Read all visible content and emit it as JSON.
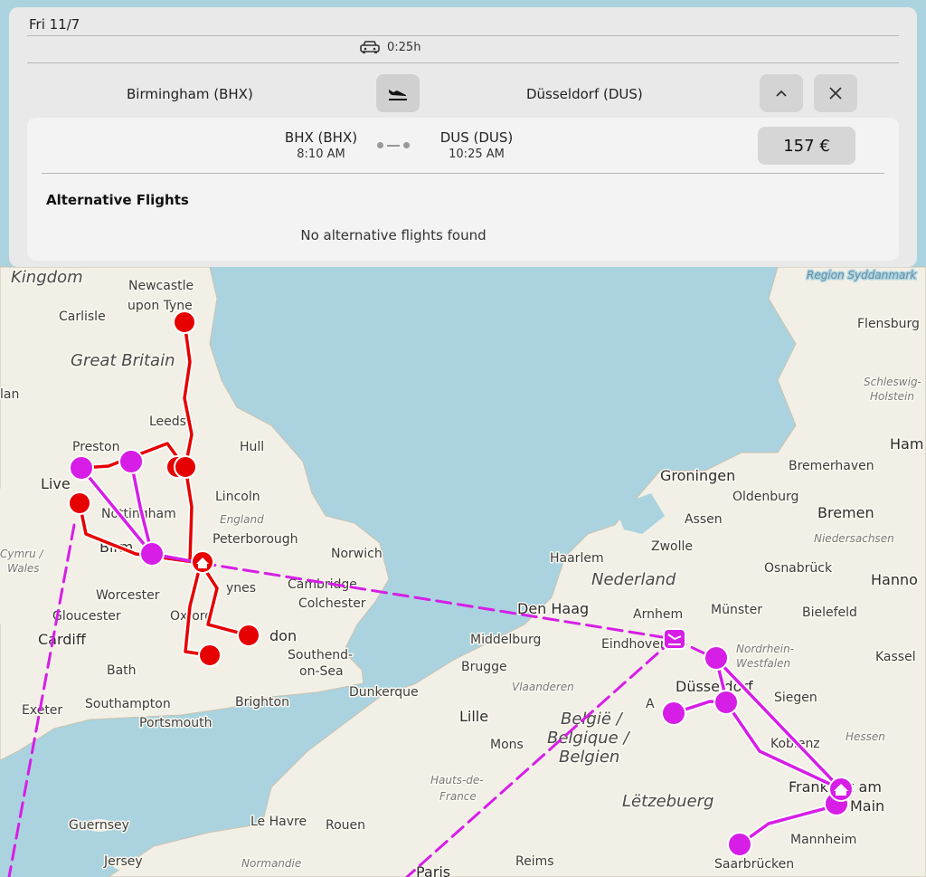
{
  "panel": {
    "date": "Fri 11/7",
    "drive_time": "0:25h",
    "from": "Birmingham (BHX)",
    "to": "Düsseldorf (DUS)",
    "segment": {
      "dep_code": "BHX (BHX)",
      "dep_time": "8:10 AM",
      "arr_code": "DUS (DUS)",
      "arr_time": "10:25 AM",
      "price": "157 €"
    },
    "alternative_title": "Alternative Flights",
    "alternative_message": "No alternative flights found"
  },
  "map": {
    "labels": {
      "kingdom": "Kingdom",
      "newcastle": "Newcastle",
      "upon_tyne": "upon Tyne",
      "carlisle": "Carlisle",
      "great_britain": "Great Britain",
      "lan": "lan",
      "leeds": "Leeds",
      "preston": "Preston",
      "hull": "Hull",
      "live": "Live",
      "lincoln": "Lincoln",
      "nottingham": "Nottingham",
      "england": "England",
      "peterborough": "Peterborough",
      "norwich": "Norwich",
      "cymru": "Cymru /",
      "wales": "Wales",
      "birm": "Birm",
      "cambridge": "Cambridge",
      "worcester": "Worcester",
      "keynes": "ynes",
      "colchester": "Colchester",
      "gloucester": "Gloucester",
      "oxford": "Oxford",
      "cardiff": "Cardiff",
      "london": "don",
      "southend": "Southend-",
      "on_sea": "on-Sea",
      "bath": "Bath",
      "southampton": "Southampton",
      "brighton": "Brighton",
      "portsmouth": "Portsmouth",
      "exeter": "Exeter",
      "dunkerque": "Dunkerque",
      "lille": "Lille",
      "mons": "Mons",
      "hauts": "Hauts-de-",
      "france": "France",
      "guernsey": "Guernsey",
      "le_havre": "Le Havre",
      "rouen": "Rouen",
      "jersey": "Jersey",
      "normandie": "Normandie",
      "reims": "Reims",
      "paris": "Paris",
      "region_syddanmark": "Region Syddanmark",
      "flensburg": "Flensburg",
      "schleswig": "Schleswig-",
      "holstein": "Holstein",
      "ham": "Ham",
      "groningen": "Groningen",
      "bremerhaven": "Bremerhaven",
      "oldenburg": "Oldenburg",
      "bremen": "Bremen",
      "assen": "Assen",
      "niedersachsen": "Niedersachsen",
      "zwolle": "Zwolle",
      "haarlem": "Haarlem",
      "nederland": "Nederland",
      "osnabruck": "Osnabrück",
      "hannover": "Hanno",
      "den_haag": "Den Haag",
      "arnhem": "Arnhem",
      "munster": "Münster",
      "bielefeld": "Bielefeld",
      "middelburg": "Middelburg",
      "eindhoven": "Eindhoven",
      "nordrhein": "Nordrhein-",
      "westfalen": "Westfalen",
      "kassel": "Kassel",
      "brugge": "Brugge",
      "vlaanderen": "Vlaanderen",
      "dusseldorf": "Düsseldorf",
      "siegen": "Siegen",
      "belgie": "België /",
      "belgique": "Belgique /",
      "belgien": "Belgien",
      "koblenz": "Koblenz",
      "hessen": "Hessen",
      "frankfurt": "Frankfurt am",
      "main": "Main",
      "letzebuerg": "Lëtzebuerg",
      "mannheim": "Mannheim",
      "saarbrucken": "Saarbrücken",
      "aachen": "A"
    },
    "colors": {
      "sea": "#aad3df",
      "land": "#f2efe6",
      "red_route": "#e60000",
      "purple_route": "#d61ee6"
    }
  }
}
